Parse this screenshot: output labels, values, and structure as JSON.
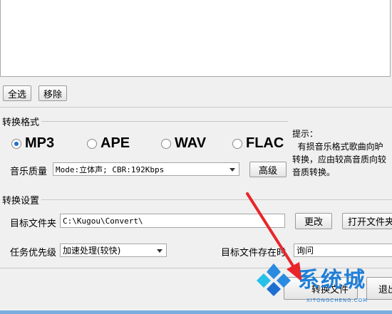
{
  "list_actions": {
    "select_all": "全选",
    "remove": "移除"
  },
  "format_section": {
    "title": "转换格式",
    "options": [
      "MP3",
      "APE",
      "WAV",
      "FLAC"
    ],
    "selected": "MP3",
    "quality_label": "音乐质量",
    "quality_value": "Mode:立体声; CBR:192Kbps",
    "advanced_button": "高级",
    "hint_title": "提示：",
    "hint_line1": "  有损音乐格式歌曲向昈",
    "hint_line2": "转换，应由较高音质向较",
    "hint_line3": "音质转换。"
  },
  "settings_section": {
    "title": "转换设置",
    "target_folder_label": "目标文件夹",
    "target_folder_value": "C:\\Kugou\\Convert\\",
    "change_button": "更改",
    "open_folder_button": "打开文件夹",
    "priority_label": "任务优先级",
    "priority_value": "加速处理(较快)",
    "exists_label": "目标文件存在时",
    "exists_value": "询问"
  },
  "footer": {
    "convert_button": "转换文件",
    "exit_button": "退出"
  },
  "watermark": {
    "title": "系统城",
    "subtitle": "XITONGCHENG.COM"
  },
  "colors": {
    "accent": "#1f6fd0",
    "arrow": "#e8262a"
  }
}
